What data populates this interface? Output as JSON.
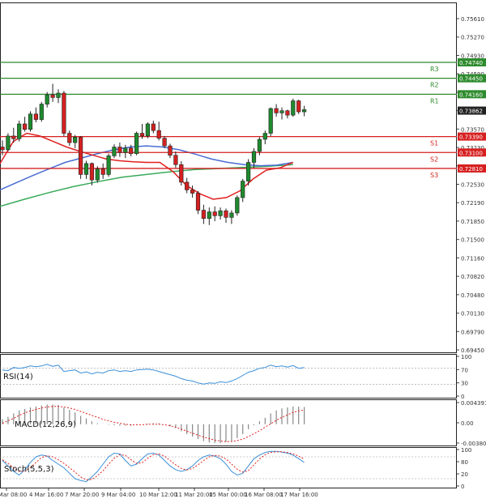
{
  "chart_data": {
    "type": "candlestick",
    "price_panel": {
      "ylim": [
        0.6945,
        0.7583
      ],
      "y_ticks": [
        "0.75610",
        "0.75270",
        "0.74930",
        "0.74590",
        "0.74250",
        "0.73910",
        "0.73570",
        "0.73230",
        "0.72890",
        "0.72530",
        "0.72190",
        "0.71850",
        "0.71500",
        "0.71160",
        "0.70820",
        "0.70480",
        "0.70130",
        "0.69790",
        "0.69450"
      ],
      "levels": [
        {
          "name": "R3",
          "value": 0.7474,
          "label": "0.74740",
          "color": "#2e8b2e"
        },
        {
          "name": "R2",
          "value": 0.7445,
          "label": "0.74450",
          "color": "#2e8b2e"
        },
        {
          "name": "R1",
          "value": 0.7416,
          "label": "0.74160",
          "color": "#2e8b2e"
        },
        {
          "name": "S1",
          "value": 0.7339,
          "label": "0.73390",
          "color": "#d62020"
        },
        {
          "name": "S2",
          "value": 0.731,
          "label": "0.73100",
          "color": "#d62020"
        },
        {
          "name": "S3",
          "value": 0.7281,
          "label": "0.72810",
          "color": "#d62020"
        }
      ],
      "current_price": {
        "value": 0.73862,
        "label": "0.73862"
      },
      "candles": [
        [
          0.732,
          0.7332,
          0.7305,
          0.7315
        ],
        [
          0.7315,
          0.7345,
          0.7312,
          0.734
        ],
        [
          0.734,
          0.7355,
          0.7328,
          0.7335
        ],
        [
          0.7335,
          0.7368,
          0.733,
          0.7362
        ],
        [
          0.7362,
          0.7375,
          0.7348,
          0.7352
        ],
        [
          0.7352,
          0.7385,
          0.7348,
          0.738
        ],
        [
          0.738,
          0.7392,
          0.7365,
          0.737
        ],
        [
          0.737,
          0.7402,
          0.7366,
          0.7398
        ],
        [
          0.7398,
          0.742,
          0.7392,
          0.7415
        ],
        [
          0.7415,
          0.7435,
          0.7402,
          0.741
        ],
        [
          0.741,
          0.7425,
          0.74,
          0.7418
        ],
        [
          0.7418,
          0.7422,
          0.734,
          0.7345
        ],
        [
          0.7345,
          0.735,
          0.7322,
          0.7328
        ],
        [
          0.7328,
          0.7342,
          0.7318,
          0.7338
        ],
        [
          0.7338,
          0.734,
          0.7262,
          0.727
        ],
        [
          0.727,
          0.7295,
          0.7262,
          0.729
        ],
        [
          0.729,
          0.7292,
          0.725,
          0.726
        ],
        [
          0.726,
          0.7285,
          0.7255,
          0.728
        ],
        [
          0.728,
          0.729,
          0.7262,
          0.727
        ],
        [
          0.727,
          0.7308,
          0.7266,
          0.7304
        ],
        [
          0.7304,
          0.7325,
          0.73,
          0.732
        ],
        [
          0.732,
          0.7328,
          0.7302,
          0.731
        ],
        [
          0.731,
          0.7324,
          0.73,
          0.7318
        ],
        [
          0.7318,
          0.7324,
          0.7303,
          0.7308
        ],
        [
          0.7308,
          0.7348,
          0.7305,
          0.7345
        ],
        [
          0.7345,
          0.7362,
          0.7335,
          0.734
        ],
        [
          0.734,
          0.7365,
          0.7336,
          0.7362
        ],
        [
          0.7362,
          0.7368,
          0.7345,
          0.735
        ],
        [
          0.735,
          0.7366,
          0.7332,
          0.7336
        ],
        [
          0.7336,
          0.734,
          0.7318,
          0.7322
        ],
        [
          0.7322,
          0.7326,
          0.73,
          0.7305
        ],
        [
          0.7305,
          0.7312,
          0.7282,
          0.7288
        ],
        [
          0.7288,
          0.7294,
          0.725,
          0.7256
        ],
        [
          0.7256,
          0.7264,
          0.7236,
          0.7242
        ],
        [
          0.7242,
          0.725,
          0.7228,
          0.7236
        ],
        [
          0.7236,
          0.724,
          0.7198,
          0.7205
        ],
        [
          0.7205,
          0.7215,
          0.718,
          0.719
        ],
        [
          0.719,
          0.721,
          0.7178,
          0.7202
        ],
        [
          0.7202,
          0.7212,
          0.7185,
          0.7195
        ],
        [
          0.7195,
          0.721,
          0.7188,
          0.7204
        ],
        [
          0.7204,
          0.7208,
          0.7182,
          0.7192
        ],
        [
          0.7192,
          0.7205,
          0.718,
          0.72
        ],
        [
          0.72,
          0.7232,
          0.7195,
          0.7228
        ],
        [
          0.7228,
          0.7262,
          0.722,
          0.7258
        ],
        [
          0.7258,
          0.7298,
          0.725,
          0.7292
        ],
        [
          0.7292,
          0.7318,
          0.7282,
          0.7312
        ],
        [
          0.7312,
          0.7338,
          0.7305,
          0.7334
        ],
        [
          0.7334,
          0.735,
          0.7325,
          0.7345
        ],
        [
          0.7345,
          0.7392,
          0.734,
          0.739
        ],
        [
          0.739,
          0.7398,
          0.7375,
          0.7382
        ],
        [
          0.7382,
          0.7392,
          0.737,
          0.7386
        ],
        [
          0.7386,
          0.7388,
          0.7372,
          0.7378
        ],
        [
          0.7378,
          0.7408,
          0.7375,
          0.7404
        ],
        [
          0.7404,
          0.7406,
          0.738,
          0.7384
        ],
        [
          0.7384,
          0.7395,
          0.7376,
          0.7388
        ]
      ],
      "ma_fast": {
        "color": "#e02020",
        "values": [
          0.729,
          0.733,
          0.7345,
          0.734,
          0.733,
          0.732,
          0.7312,
          0.7305,
          0.7298,
          0.7295,
          0.7293,
          0.7292,
          0.7292,
          0.7275,
          0.725,
          0.7235,
          0.7225,
          0.7228,
          0.724,
          0.7262,
          0.7278,
          0.7282,
          0.7292
        ]
      },
      "ma_mid": {
        "color": "#4a6cd4",
        "values": [
          0.7242,
          0.7255,
          0.7268,
          0.728,
          0.7292,
          0.73,
          0.7308,
          0.7315,
          0.732,
          0.7322,
          0.732,
          0.7315,
          0.7307,
          0.7298,
          0.7292,
          0.7288,
          0.7286,
          0.7287,
          0.7292
        ]
      },
      "ma_slow": {
        "color": "#3aaa5a",
        "values": [
          0.7212,
          0.7225,
          0.7237,
          0.7248,
          0.7257,
          0.7265,
          0.727,
          0.7275,
          0.7279,
          0.7281,
          0.7283,
          0.7285,
          0.7288
        ]
      }
    },
    "rsi_panel": {
      "label": "RSI(14)",
      "y_ticks": [
        "100",
        "70",
        "30",
        "0"
      ],
      "values": [
        66,
        64,
        72,
        70,
        72,
        76,
        74,
        76,
        80,
        75,
        78,
        62,
        64,
        66,
        58,
        61,
        56,
        60,
        58,
        64,
        66,
        62,
        64,
        62,
        66,
        67,
        68,
        66,
        62,
        58,
        54,
        50,
        44,
        40,
        38,
        33,
        30,
        33,
        32,
        36,
        34,
        38,
        44,
        52,
        60,
        64,
        70,
        72,
        78,
        74,
        76,
        73,
        77,
        70,
        72
      ]
    },
    "macd_panel": {
      "label": "MACD(12,26,9)",
      "y_ticks": [
        "0.004391",
        "0.00",
        "-0.003806"
      ],
      "histogram": [
        0.001,
        0.0015,
        0.0022,
        0.0028,
        0.0031,
        0.0034,
        0.0036,
        0.0038,
        0.004,
        0.004,
        0.0039,
        0.0034,
        0.0029,
        0.0024,
        0.0017,
        0.0012,
        0.0006,
        0.0002,
        0.0,
        -0.0001,
        -0.0002,
        -0.0003,
        -0.0003,
        -0.0003,
        -0.0001,
        0.0,
        0.0001,
        0.0002,
        0.0002,
        0.0,
        -0.0004,
        -0.0008,
        -0.0014,
        -0.002,
        -0.0025,
        -0.003,
        -0.0034,
        -0.0037,
        -0.0038,
        -0.0038,
        -0.0036,
        -0.0034,
        -0.0028,
        -0.002,
        -0.001,
        -0.0002,
        0.0006,
        0.0013,
        0.0022,
        0.0028,
        0.0032,
        0.0034,
        0.0036,
        0.0036,
        0.0035
      ],
      "signal": [
        0.0002,
        0.0007,
        0.0012,
        0.0018,
        0.0023,
        0.0027,
        0.003,
        0.0033,
        0.0035,
        0.0036,
        0.0036,
        0.0035,
        0.0033,
        0.003,
        0.0026,
        0.0022,
        0.0018,
        0.0014,
        0.001,
        0.0007,
        0.0004,
        0.0002,
        0.0,
        -0.0001,
        -0.0001,
        -0.0001,
        0.0,
        0.0,
        0.0,
        -0.0001,
        -0.0003,
        -0.0006,
        -0.001,
        -0.0014,
        -0.0018,
        -0.0022,
        -0.0026,
        -0.0029,
        -0.0032,
        -0.0034,
        -0.0035,
        -0.0035,
        -0.0033,
        -0.003,
        -0.0025,
        -0.0019,
        -0.0013,
        -0.0006,
        0.0001,
        0.0008,
        0.0014,
        0.0019,
        0.0024,
        0.0027,
        0.0029
      ]
    },
    "stoch_panel": {
      "label": "Stoch(5,5,3)",
      "y_ticks": [
        "100",
        "80",
        "20",
        "0"
      ],
      "k": [
        70,
        55,
        40,
        30,
        45,
        65,
        80,
        85,
        82,
        70,
        60,
        50,
        35,
        20,
        15,
        12,
        25,
        40,
        60,
        80,
        90,
        88,
        70,
        55,
        60,
        75,
        88,
        90,
        85,
        70,
        55,
        45,
        40,
        45,
        55,
        70,
        80,
        85,
        82,
        75,
        60,
        40,
        30,
        35,
        55,
        75,
        85,
        92,
        95,
        95,
        93,
        90,
        85,
        75,
        65
      ],
      "d": [
        72,
        62,
        50,
        40,
        40,
        50,
        65,
        78,
        83,
        80,
        72,
        62,
        50,
        38,
        25,
        17,
        18,
        28,
        42,
        60,
        76,
        86,
        84,
        72,
        62,
        64,
        76,
        86,
        88,
        82,
        70,
        58,
        48,
        44,
        48,
        58,
        70,
        80,
        84,
        82,
        74,
        60,
        46,
        38,
        42,
        58,
        74,
        86,
        92,
        94,
        94,
        92,
        88,
        82,
        74
      ]
    },
    "x_ticks": [
      "4 Mar 08:00",
      "4 Mar 16:00",
      "7 Mar 20:00",
      "9 Mar 04:00",
      "10 Mar 12:00",
      "11 Mar 20:00",
      "15 Mar 00:00",
      "16 Mar 08:00",
      "17 Mar 16:00"
    ]
  }
}
